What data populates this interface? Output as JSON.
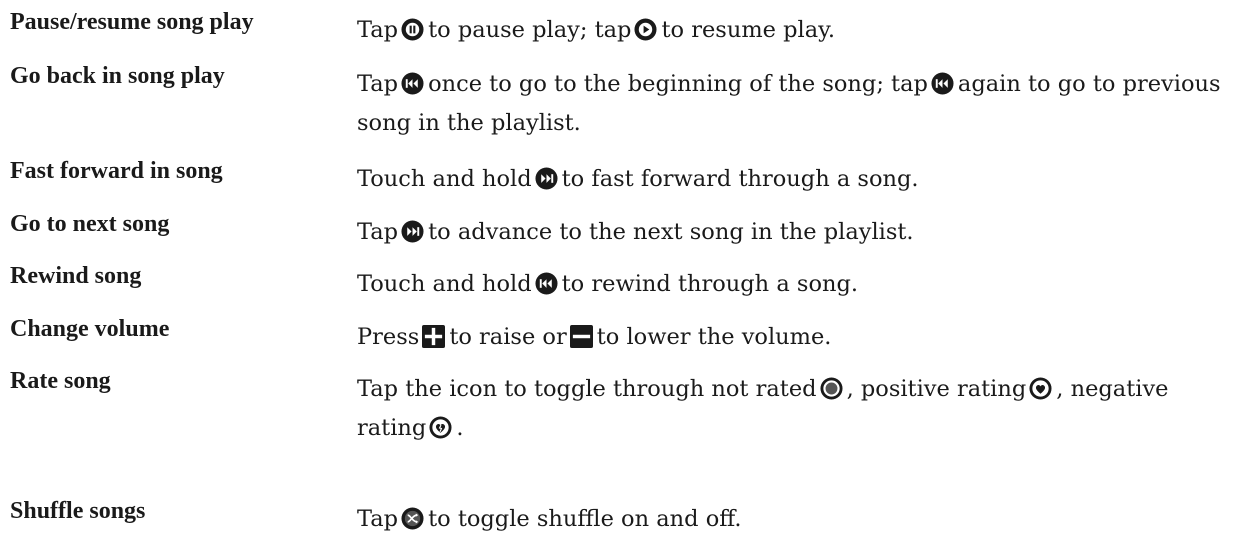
{
  "rows": [
    {
      "term": "Pause/resume song play",
      "desc": [
        {
          "t": "Tap"
        },
        {
          "icon": "pause-icon"
        },
        {
          "t": "to pause play; tap"
        },
        {
          "icon": "play-icon"
        },
        {
          "t": "to resume play."
        }
      ]
    },
    {
      "term": "Go back in song play",
      "desc": [
        {
          "t": "Tap"
        },
        {
          "icon": "previous-icon"
        },
        {
          "t": "once to go to the beginning of the song; tap"
        },
        {
          "icon": "previous-icon"
        },
        {
          "t": "again to go to previous song in the playlist."
        }
      ]
    },
    {
      "term": "Fast forward in song",
      "desc": [
        {
          "t": "Touch and hold"
        },
        {
          "icon": "next-icon"
        },
        {
          "t": "to fast forward through a song."
        }
      ]
    },
    {
      "term": "Go to next song",
      "desc": [
        {
          "t": "Tap"
        },
        {
          "icon": "next-icon"
        },
        {
          "t": "to advance to the next song in the playlist."
        }
      ]
    },
    {
      "term": "Rewind song",
      "desc": [
        {
          "t": "Touch and hold"
        },
        {
          "icon": "previous-icon"
        },
        {
          "t": "to rewind through a song."
        }
      ]
    },
    {
      "term": "Change volume",
      "desc": [
        {
          "t": "Press"
        },
        {
          "icon": "volume-up-icon"
        },
        {
          "t": "to raise or"
        },
        {
          "icon": "volume-down-icon"
        },
        {
          "t": "to lower the volume."
        }
      ]
    },
    {
      "term": "Rate song",
      "desc": [
        {
          "t": "Tap the icon to toggle through not rated"
        },
        {
          "icon": "rating-none-icon"
        },
        {
          "t": ", positive rating"
        },
        {
          "icon": "rating-positive-icon"
        },
        {
          "t": ", negative rating"
        },
        {
          "icon": "rating-negative-icon"
        },
        {
          "t": "."
        }
      ]
    },
    {
      "term": "Shuffle songs",
      "desc": [
        {
          "t": "Tap"
        },
        {
          "icon": "shuffle-icon"
        },
        {
          "t": "to toggle shuffle on and off."
        }
      ]
    }
  ],
  "colors": {
    "text": "#1a1a1a",
    "icon": "#1a1a1a",
    "icon_inner": "#ffffff",
    "rating_fill": "#555555"
  }
}
